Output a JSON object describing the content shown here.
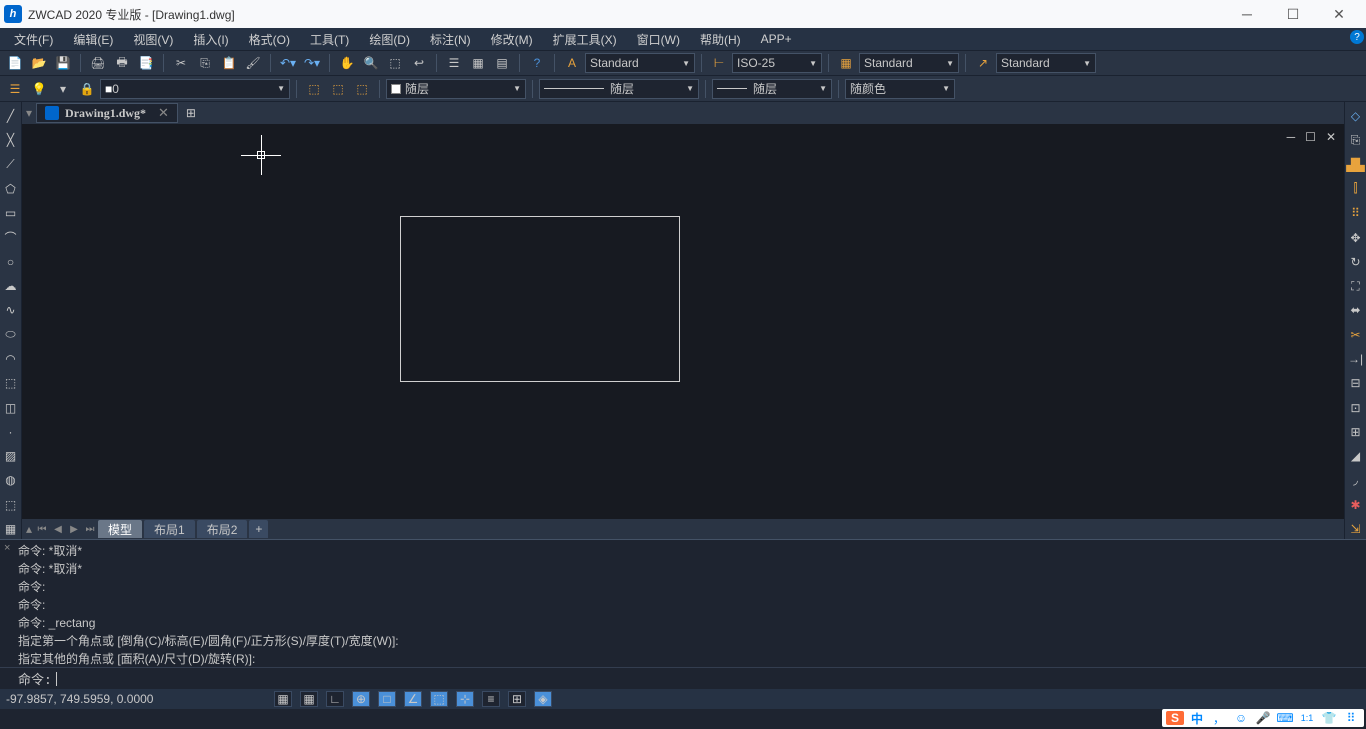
{
  "app": {
    "title": "ZWCAD 2020 专业版 - [Drawing1.dwg]",
    "logo_letter": "h"
  },
  "menu": [
    "文件(F)",
    "编辑(E)",
    "视图(V)",
    "插入(I)",
    "格式(O)",
    "工具(T)",
    "绘图(D)",
    "标注(N)",
    "修改(M)",
    "扩展工具(X)",
    "窗口(W)",
    "帮助(H)",
    "APP+"
  ],
  "styles": {
    "text_style": "Standard",
    "dim_style": "ISO-25",
    "table_style": "Standard",
    "mleader_style": "Standard"
  },
  "layers": {
    "current": "0"
  },
  "props": {
    "color_label": "随层",
    "linetype_label": "随层",
    "lineweight_label": "随层",
    "plotstyle_label": "随颜色"
  },
  "tabs": {
    "drawing_tab": "Drawing1.dwg*"
  },
  "layout": {
    "model": "模型",
    "layout1": "布局1",
    "layout2": "布局2",
    "add": "+"
  },
  "cmd": {
    "history": [
      "命令: *取消*",
      "命令: *取消*",
      "命令:",
      "命令:",
      "命令: _rectang",
      "指定第一个角点或 [倒角(C)/标高(E)/圆角(F)/正方形(S)/厚度(T)/宽度(W)]:",
      "指定其他的角点或 [面积(A)/尺寸(D)/旋转(R)]:"
    ],
    "prompt": "命令:"
  },
  "status": {
    "coords": "-97.9857, 749.5959, 0.0000"
  },
  "tray": {
    "ime": "中",
    "punct": "，",
    "ratio": "1:1"
  },
  "help_badge": "?"
}
